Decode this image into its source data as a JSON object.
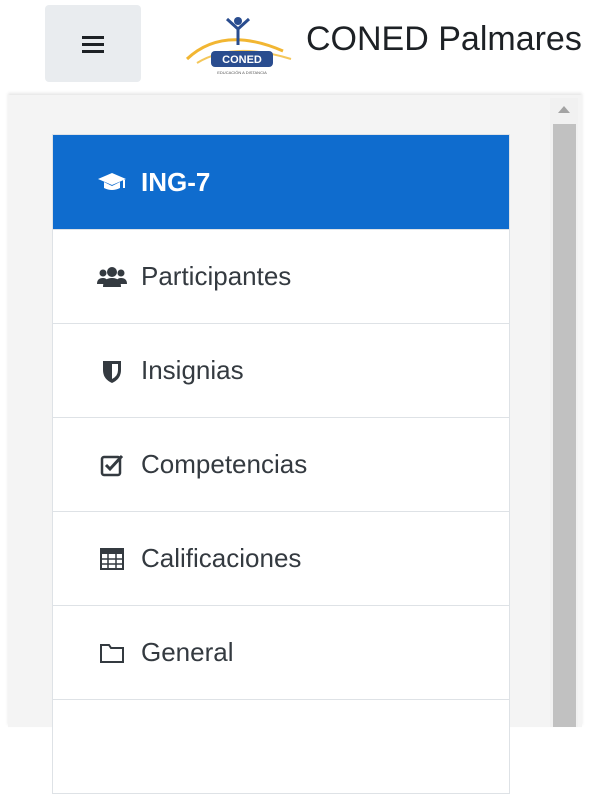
{
  "header": {
    "site_title": "CONED Palmares",
    "logo_text": "CONED",
    "logo_tagline": "EDUCACIÓN A DISTANCIA"
  },
  "navigation": {
    "items": [
      {
        "label": "ING-7",
        "icon": "graduation-cap-icon",
        "active": true
      },
      {
        "label": "Participantes",
        "icon": "users-icon",
        "active": false
      },
      {
        "label": "Insignias",
        "icon": "shield-icon",
        "active": false
      },
      {
        "label": "Competencias",
        "icon": "checkbox-icon",
        "active": false
      },
      {
        "label": "Calificaciones",
        "icon": "table-icon",
        "active": false
      },
      {
        "label": "General",
        "icon": "folder-icon",
        "active": false
      }
    ]
  },
  "colors": {
    "accent": "#0f6cce",
    "drawer_bg": "#f4f4f4",
    "text": "#343a40"
  }
}
